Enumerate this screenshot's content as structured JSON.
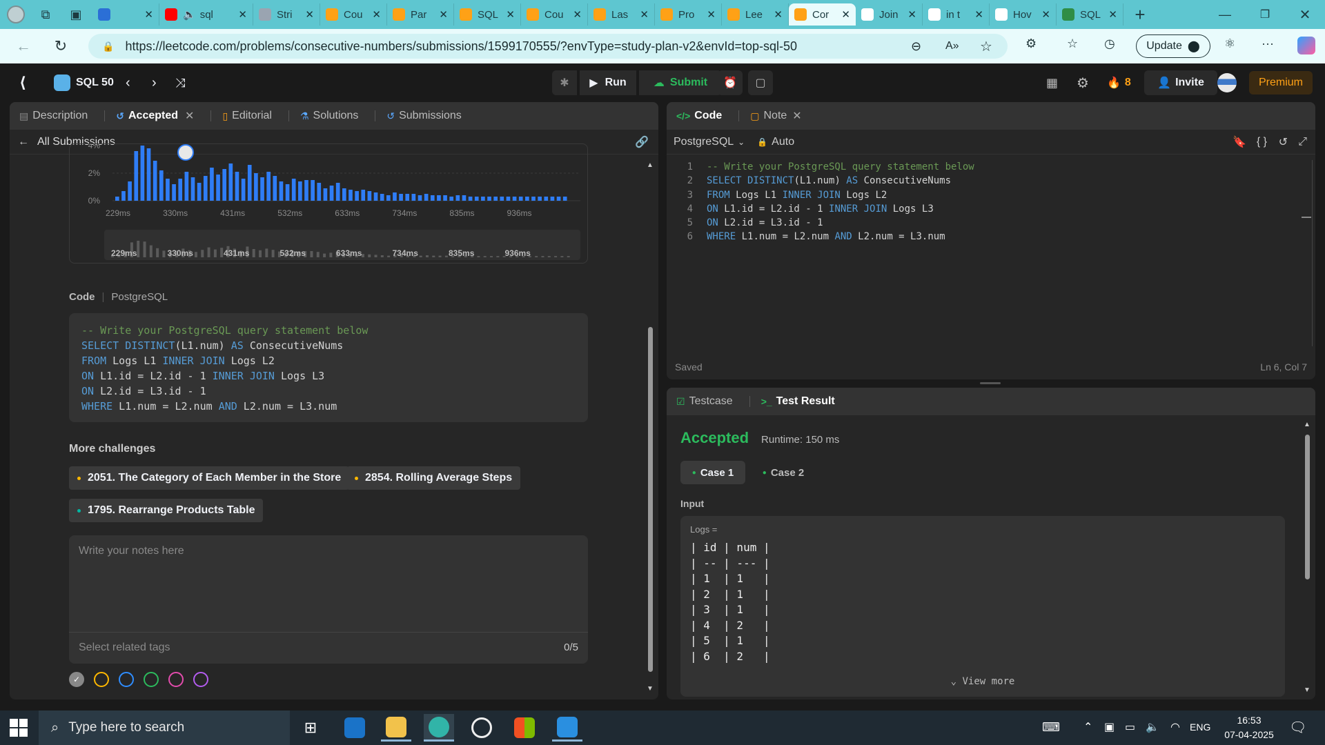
{
  "browser": {
    "tabs": [
      {
        "label": "",
        "favicon": "copilot-icon",
        "color": "#2b6fd6"
      },
      {
        "label": "sql",
        "favicon": "youtube-icon",
        "color": "#ff0000",
        "muted": true
      },
      {
        "label": "Stri",
        "favicon": "tuf-icon",
        "color": "#9aa4b1"
      },
      {
        "label": "Cou",
        "favicon": "leetcode-icon",
        "color": "#ffa116"
      },
      {
        "label": "Par",
        "favicon": "leetcode-icon",
        "color": "#ffa116"
      },
      {
        "label": "SQL",
        "favicon": "leetcode-icon",
        "color": "#ffa116"
      },
      {
        "label": "Cou",
        "favicon": "leetcode-icon",
        "color": "#ffa116"
      },
      {
        "label": "Las",
        "favicon": "leetcode-icon",
        "color": "#ffa116"
      },
      {
        "label": "Pro",
        "favicon": "leetcode-icon",
        "color": "#ffa116"
      },
      {
        "label": "Lee",
        "favicon": "leetcode-icon",
        "color": "#ffa116"
      },
      {
        "label": "Cor",
        "favicon": "leetcode-icon",
        "color": "#ffa116",
        "active": true
      },
      {
        "label": "Join",
        "favicon": "openai-icon",
        "color": "#ffffff"
      },
      {
        "label": "in t",
        "favicon": "google-icon",
        "color": "#ffffff"
      },
      {
        "label": "Hov",
        "favicon": "google-icon",
        "color": "#ffffff"
      },
      {
        "label": "SQL",
        "favicon": "gfg-icon",
        "color": "#2f8d46"
      }
    ],
    "url": "https://leetcode.com/problems/consecutive-numbers/submissions/1599170555/?envType=study-plan-v2&envId=top-sql-50",
    "update_label": "Update"
  },
  "header": {
    "study_plan": "SQL 50",
    "run_label": "Run",
    "submit_label": "Submit",
    "streak": "8",
    "invite_label": "Invite",
    "premium_label": "Premium"
  },
  "left": {
    "tabs": {
      "description": "Description",
      "accepted": "Accepted",
      "editorial": "Editorial",
      "solutions": "Solutions",
      "submissions": "Submissions"
    },
    "back_label": "All Submissions",
    "chart_data": {
      "type": "bar",
      "ylabel": "",
      "yticks": [
        "4%",
        "2%",
        "0%"
      ],
      "x_ticks": [
        "229ms",
        "330ms",
        "431ms",
        "532ms",
        "633ms",
        "734ms",
        "835ms",
        "936ms"
      ],
      "values": [
        0.3,
        0.7,
        1.4,
        3.6,
        4.1,
        3.8,
        2.9,
        2.2,
        1.6,
        1.2,
        1.6,
        2.1,
        1.7,
        1.3,
        1.8,
        2.4,
        1.9,
        2.3,
        2.7,
        2.1,
        1.6,
        2.6,
        2.0,
        1.7,
        2.1,
        1.8,
        1.4,
        1.2,
        1.6,
        1.4,
        1.5,
        1.5,
        1.3,
        0.9,
        1.1,
        1.3,
        0.9,
        0.8,
        0.7,
        0.8,
        0.7,
        0.6,
        0.5,
        0.4,
        0.6,
        0.5,
        0.5,
        0.5,
        0.4,
        0.5,
        0.4,
        0.4,
        0.4,
        0.3,
        0.4,
        0.4,
        0.3,
        0.3,
        0.3,
        0.3,
        0.3,
        0.3,
        0.3,
        0.3,
        0.3,
        0.3,
        0.3,
        0.3,
        0.3,
        0.3,
        0.3,
        0.3
      ],
      "ylim": [
        0,
        4
      ]
    },
    "code_label": "Code",
    "lang_label": "PostgreSQL",
    "more_challenges": "More challenges",
    "challenges": [
      {
        "label": "2051. The Category of Each Member in the Store",
        "color": "#ffb800"
      },
      {
        "label": "2854. Rolling Average Steps",
        "color": "#ffb800"
      },
      {
        "label": "1795. Rearrange Products Table",
        "color": "#00b8a3"
      }
    ],
    "notes_placeholder": "Write your notes here",
    "tags_placeholder": "Select related tags",
    "tags_count": "0/5",
    "note_colors": [
      "#aaaaaa",
      "#ffb800",
      "#2f8dff",
      "#2cbb5d",
      "#e34cad",
      "#b45cf0"
    ]
  },
  "code_lines": [
    [
      {
        "t": "-- Write your PostgreSQL query statement below",
        "c": "cm"
      }
    ],
    [
      {
        "t": "SELECT DISTINCT",
        "c": "kw"
      },
      {
        "t": "(L1.num) ",
        "c": "pl"
      },
      {
        "t": "AS",
        "c": "kw"
      },
      {
        "t": " ConsecutiveNums",
        "c": "pl"
      }
    ],
    [
      {
        "t": "FROM",
        "c": "kw"
      },
      {
        "t": " Logs L1 ",
        "c": "pl"
      },
      {
        "t": "INNER JOIN",
        "c": "kw"
      },
      {
        "t": " Logs L2",
        "c": "pl"
      }
    ],
    [
      {
        "t": "ON",
        "c": "kw"
      },
      {
        "t": " L1.id = L2.id - 1 ",
        "c": "pl"
      },
      {
        "t": "INNER JOIN",
        "c": "kw"
      },
      {
        "t": " Logs L3",
        "c": "pl"
      }
    ],
    [
      {
        "t": "ON",
        "c": "kw"
      },
      {
        "t": " L2.id = L3.id - 1",
        "c": "pl"
      }
    ],
    [
      {
        "t": "WHERE",
        "c": "kw"
      },
      {
        "t": " L1.num = L2.num ",
        "c": "pl"
      },
      {
        "t": "AND",
        "c": "kw"
      },
      {
        "t": " L2.num = L3.num",
        "c": "pl"
      }
    ]
  ],
  "editor": {
    "tab_code": "Code",
    "tab_note": "Note",
    "language": "PostgreSQL",
    "mode": "Auto",
    "status": "Saved",
    "cursor": "Ln 6, Col 7"
  },
  "result": {
    "tab_testcase": "Testcase",
    "tab_result": "Test Result",
    "verdict": "Accepted",
    "runtime": "Runtime: 150 ms",
    "case1": "Case 1",
    "case2": "Case 2",
    "input_label": "Input",
    "logs_label": "Logs =",
    "table_lines": [
      "| id | num |",
      "| -- | --- |",
      "| 1  | 1   |",
      "| 2  | 1   |",
      "| 3  | 1   |",
      "| 4  | 2   |",
      "| 5  | 1   |",
      "| 6  | 2   |"
    ],
    "view_more": "View more"
  },
  "taskbar": {
    "search_placeholder": "Type here to search",
    "language": "ENG",
    "time": "16:53",
    "date": "07-04-2025"
  }
}
